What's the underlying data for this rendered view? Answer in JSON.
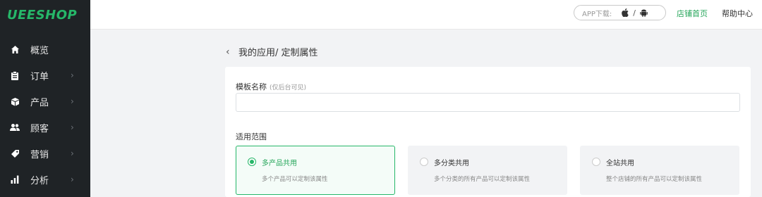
{
  "logo": "UEESHOP",
  "sidebar": {
    "items": [
      {
        "label": "概览",
        "icon": "home-icon",
        "chevron": ""
      },
      {
        "label": "订单",
        "icon": "clipboard-icon",
        "chevron": "›"
      },
      {
        "label": "产品",
        "icon": "box-icon",
        "chevron": "›"
      },
      {
        "label": "顾客",
        "icon": "users-icon",
        "chevron": "›"
      },
      {
        "label": "营销",
        "icon": "tag-icon",
        "chevron": "›"
      },
      {
        "label": "分析",
        "icon": "bar-chart-icon",
        "chevron": "›"
      }
    ]
  },
  "topbar": {
    "app_download": "APP下载:",
    "separator": "/",
    "store_home": "店铺首页",
    "help_center": "帮助中心"
  },
  "breadcrumb": {
    "back": "‹",
    "text": "我的应用/ 定制属性"
  },
  "form": {
    "name_label": "模板名称",
    "name_hint": "(仅后台可见)",
    "name_value": "",
    "name_placeholder": "",
    "scope_label": "适用范围",
    "options": [
      {
        "title": "多产品共用",
        "desc": "多个产品可以定制该属性",
        "selected": true
      },
      {
        "title": "多分类共用",
        "desc": "多个分类的所有产品可以定制该属性",
        "selected": false
      },
      {
        "title": "全站共用",
        "desc": "整个店铺的所有产品可以定制该属性",
        "selected": false
      }
    ]
  },
  "colors": {
    "brand": "#26b769",
    "sidebar_bg": "#1f2326",
    "page_bg": "#f2f3f5"
  }
}
